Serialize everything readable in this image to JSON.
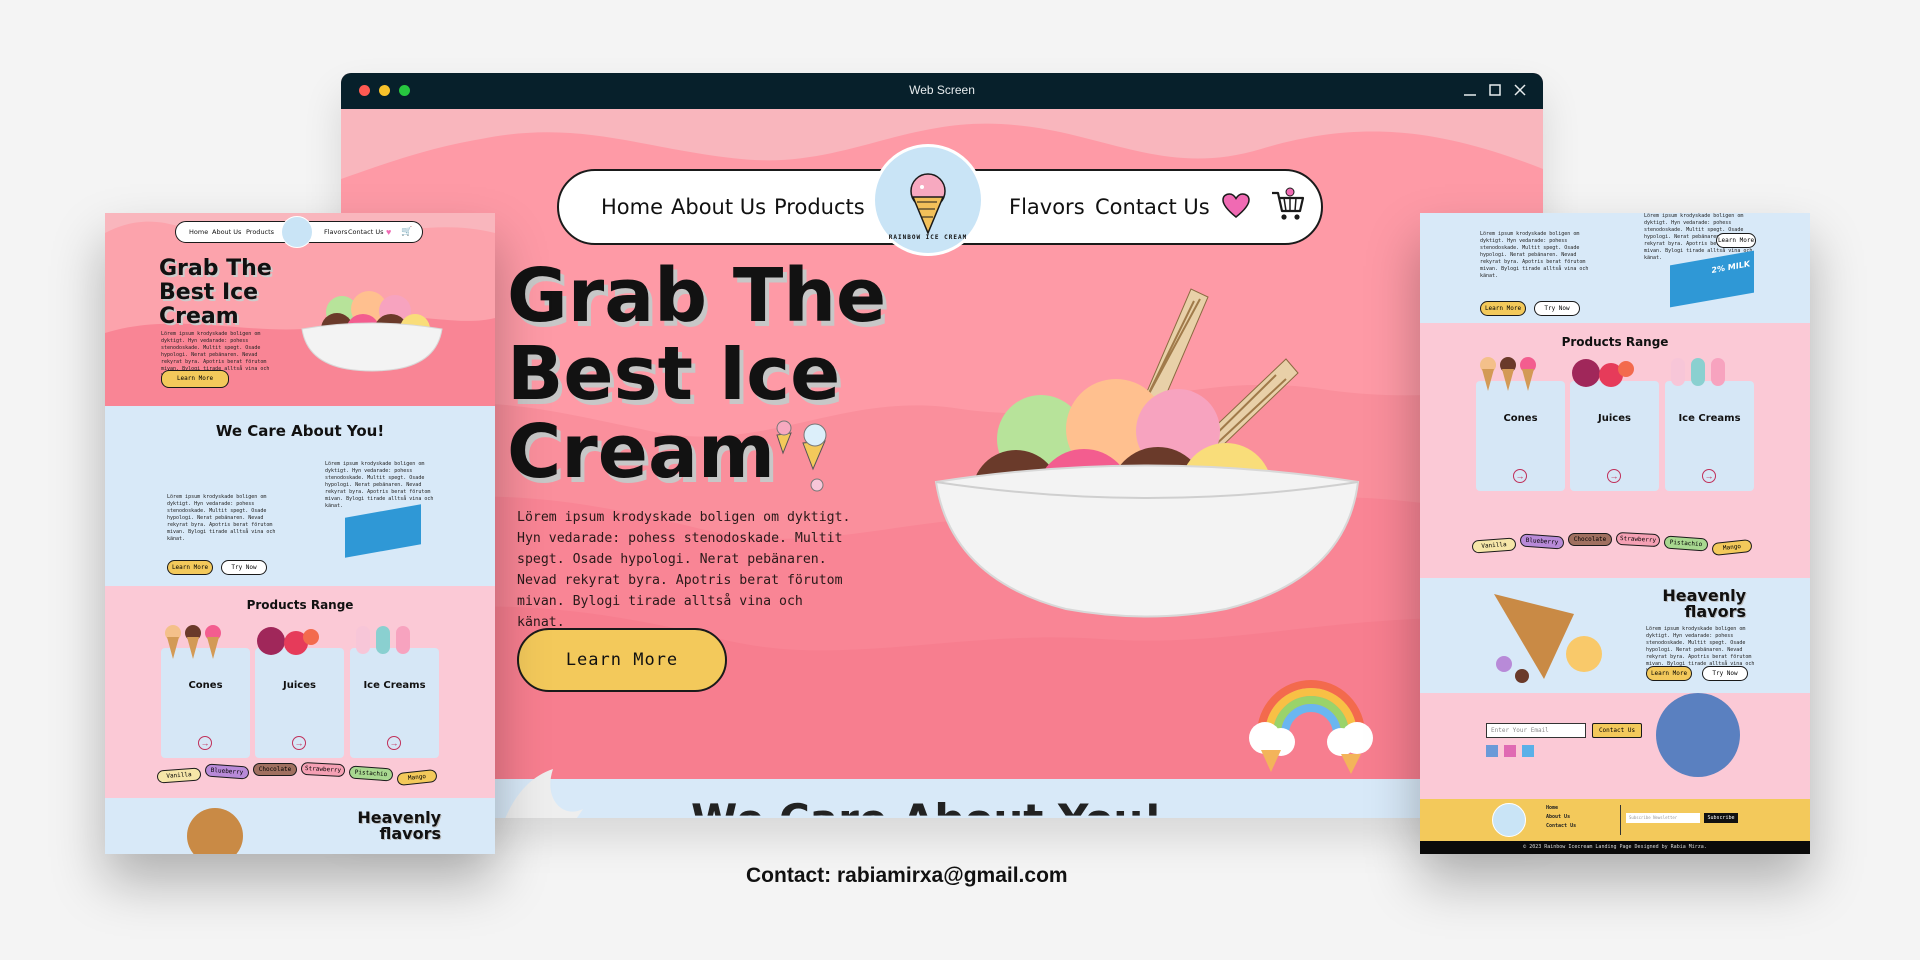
{
  "window": {
    "title": "Web Screen"
  },
  "nav": {
    "home": "Home",
    "about": "About Us",
    "products": "Products",
    "flavors": "Flavors",
    "contact": "Contact Us",
    "logo_text": "RAINBOW ICE CREAM"
  },
  "hero": {
    "title_lines": [
      "Grab The",
      "Best Ice",
      "Cream"
    ],
    "text": "Lörem ipsum krodyskade boligen om dyktigt. Hyn vedarade: pohess stenodoskade. Multit spegt. Osade hypologi. Nerat pebänaren. Nevad rekyrat byra. Apotris berat förutom mivan. Bylogi tirade alltså vina och känat.",
    "button": "Learn More"
  },
  "sections": {
    "care_title": "We Care About You!",
    "products_title": "Products Range",
    "heavenly_line1": "Heavenly",
    "heavenly_line2": "flavors",
    "learn_more": "Learn More",
    "try_now": "Try Now",
    "milk_label": "2% MILK"
  },
  "products": [
    {
      "name": "Cones"
    },
    {
      "name": "Juices"
    },
    {
      "name": "Ice Creams"
    }
  ],
  "flavors": [
    "Vanilla",
    "Blueberry",
    "Chocolate",
    "Strawberry",
    "Pistachio",
    "Mango"
  ],
  "footer": {
    "email_placeholder": "Enter Your Email",
    "contact_button": "Contact Us",
    "links": [
      "Home",
      "About Us",
      "Contact Us"
    ],
    "subscribe": "Subscribe",
    "newsletter_placeholder": "Subscribe Newsletter",
    "copyright": "© 2023 Rainbow Icecream Landing Page Designed by Rabia Mirza."
  },
  "contact_line": "Contact: rabiamirxa@gmail.com",
  "colors": {
    "pink": "#fca3ac",
    "blue": "#d8e9f8",
    "yellow": "#f3c95b",
    "dark": "#07202b"
  },
  "icons": [
    "heart-icon",
    "cart-icon",
    "close-icon",
    "minimize-icon",
    "maximize-icon",
    "ice-cream-cone-icon",
    "arrow-right-icon"
  ]
}
